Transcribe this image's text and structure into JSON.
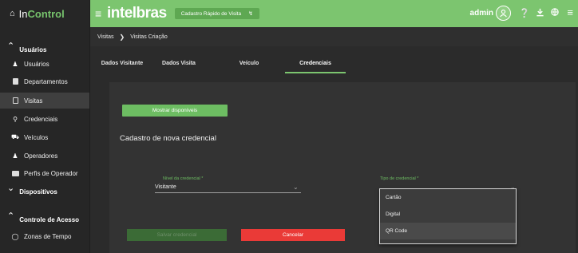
{
  "app": {
    "brand_in": "In",
    "brand_control": "Control",
    "logo": "intelbras"
  },
  "topbar": {
    "quick_register": "Cadastro Rápido de Visita",
    "user": "admin"
  },
  "sidebar": {
    "sections": [
      {
        "label": "Usuários"
      },
      {
        "label": "Dispositivos"
      },
      {
        "label": "Controle de Acesso"
      }
    ],
    "items": [
      {
        "label": "Usuários"
      },
      {
        "label": "Departamentos"
      },
      {
        "label": "Visitas"
      },
      {
        "label": "Credenciais"
      },
      {
        "label": "Veículos"
      },
      {
        "label": "Operadores"
      },
      {
        "label": "Perfis de Operador"
      },
      {
        "label": "Zonas de Tempo"
      }
    ]
  },
  "breadcrumb": {
    "root": "Visitas",
    "current": "Visitas Criação"
  },
  "tabs": [
    {
      "label": "Dados Visitante"
    },
    {
      "label": "Dados Visita"
    },
    {
      "label": "Veículo"
    },
    {
      "label": "Credenciais"
    }
  ],
  "form": {
    "show_available": "Mostrar disponíveis",
    "title": "Cadastro de nova credencial",
    "level": {
      "label": "Nível da credencial *",
      "value": "Visitante"
    },
    "type": {
      "label": "Tipo de credencial *",
      "value": ""
    },
    "save": "Salvar credencial",
    "cancel": "Cancelar"
  },
  "dropdown": {
    "options": [
      "Cartão",
      "Digital",
      "QR Code"
    ]
  },
  "colors": {
    "accent": "#7cc56f",
    "cancel": "#ea3a37",
    "background": "#2b2b2b"
  }
}
